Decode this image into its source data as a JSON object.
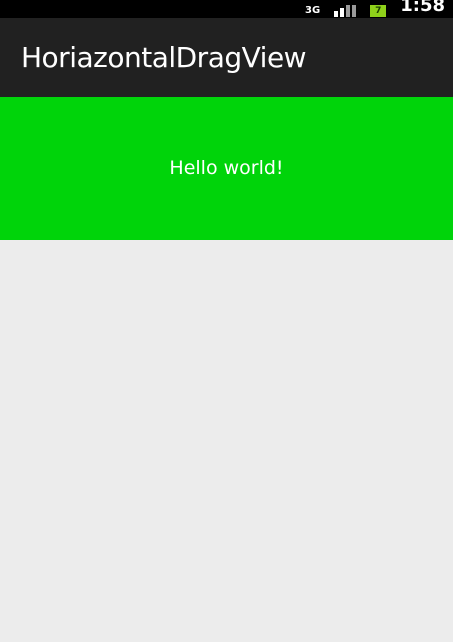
{
  "status_bar": {
    "network_label": "3G",
    "battery_label": "7",
    "time": "1:58"
  },
  "action_bar": {
    "title": "HoriazontalDragView"
  },
  "main": {
    "hello_text": "Hello world!",
    "panel_color": "#00d40a"
  },
  "icons": {
    "network": "network-type-icon",
    "signal": "signal-strength-icon",
    "battery": "battery-icon"
  }
}
